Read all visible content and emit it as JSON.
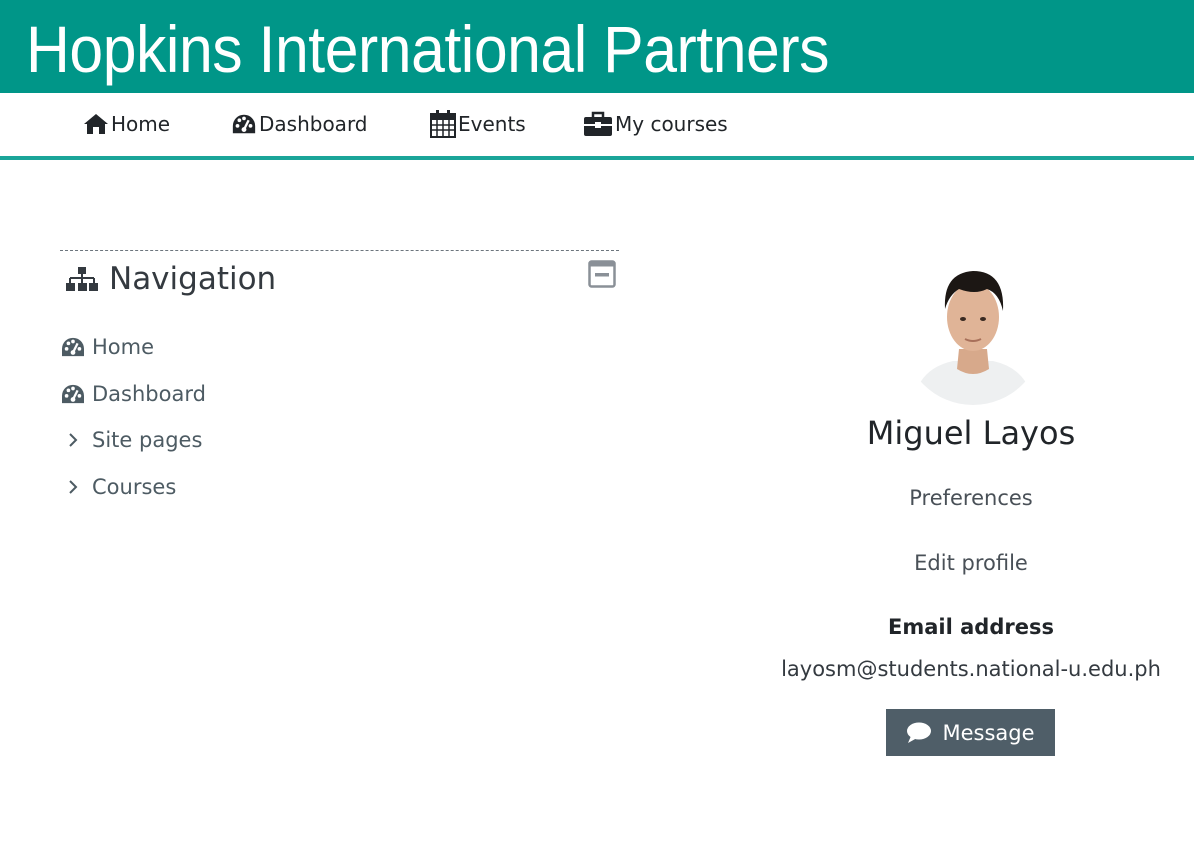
{
  "site": {
    "title": "Hopkins International Partners"
  },
  "topnav": {
    "items": [
      {
        "label": "Home",
        "icon": "home-icon"
      },
      {
        "label": "Dashboard",
        "icon": "dashboard-icon"
      },
      {
        "label": "Events",
        "icon": "calendar-icon"
      },
      {
        "label": "My courses",
        "icon": "briefcase-icon"
      }
    ]
  },
  "navigation_block": {
    "title": "Navigation",
    "items": [
      {
        "label": "Home",
        "icon": "dashboard-icon"
      },
      {
        "label": "Dashboard",
        "icon": "dashboard-icon"
      },
      {
        "label": "Site pages",
        "icon": "chevron-right-icon"
      },
      {
        "label": "Courses",
        "icon": "chevron-right-icon"
      }
    ]
  },
  "profile": {
    "name": "Miguel Layos",
    "preferences_label": "Preferences",
    "edit_profile_label": "Edit profile",
    "email_label": "Email address",
    "email": "layosm@students.national-u.edu.ph",
    "message_button": "Message"
  },
  "colors": {
    "header": "#009688",
    "nav_underline": "#1aa599",
    "button": "#4f5e68"
  }
}
